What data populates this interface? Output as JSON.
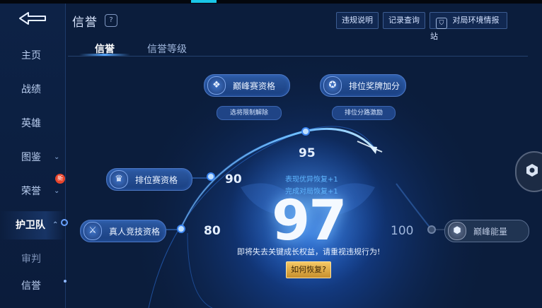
{
  "header": {
    "title": "信誉",
    "help_icon": "?",
    "buttons": [
      "违规说明",
      "记录查询",
      "对局环境情报站"
    ]
  },
  "sidebar": {
    "items": [
      {
        "label": "主页"
      },
      {
        "label": "战绩"
      },
      {
        "label": "英雄"
      },
      {
        "label": "图鉴",
        "chevron": "⌄"
      },
      {
        "label": "荣誉",
        "chevron": "⌄",
        "badge": "新"
      },
      {
        "label": "护卫队",
        "chevron": "⌃",
        "active": true
      },
      {
        "label": "审判"
      },
      {
        "label": "信誉"
      }
    ]
  },
  "tabs": [
    {
      "label": "信誉",
      "active": true
    },
    {
      "label": "信誉等级",
      "active": false
    }
  ],
  "privileges": {
    "peak_qualification": {
      "label": "巅峰赛资格",
      "pill": "选将限制解除"
    },
    "ranked_medal_bonus": {
      "label": "排位奖牌加分",
      "pill": "排位分路激励"
    },
    "ranked_qualification": {
      "label": "排位赛资格"
    },
    "real_person_competitive": {
      "label": "真人竞技资格"
    },
    "peak_energy": {
      "label": "巅峰能量"
    }
  },
  "gauge": {
    "thresholds": [
      "80",
      "90",
      "95",
      "100"
    ],
    "current_score": "97",
    "score_value": 97,
    "recover_lines": [
      "表现优异恢复+1",
      "完成对局恢复+1"
    ],
    "warning": "即将失去关键成长权益，请重视违规行为!",
    "how_to_recover": "如何恢复?"
  },
  "colors": {
    "background": "#0b1d3c",
    "accent": "#3f8cff",
    "gold_button": "#e0aa45",
    "recover_text": "#5fb6ff"
  },
  "icons": {
    "back": "back-arrow-icon",
    "help": "question-icon",
    "report_station": "shield-badge-icon",
    "peak": "diamond-cluster-icon",
    "medal": "star-medal-icon",
    "ranked": "crown-wings-icon",
    "real_person": "sword-no-bot-icon",
    "energy": "hexagon-energy-icon"
  }
}
